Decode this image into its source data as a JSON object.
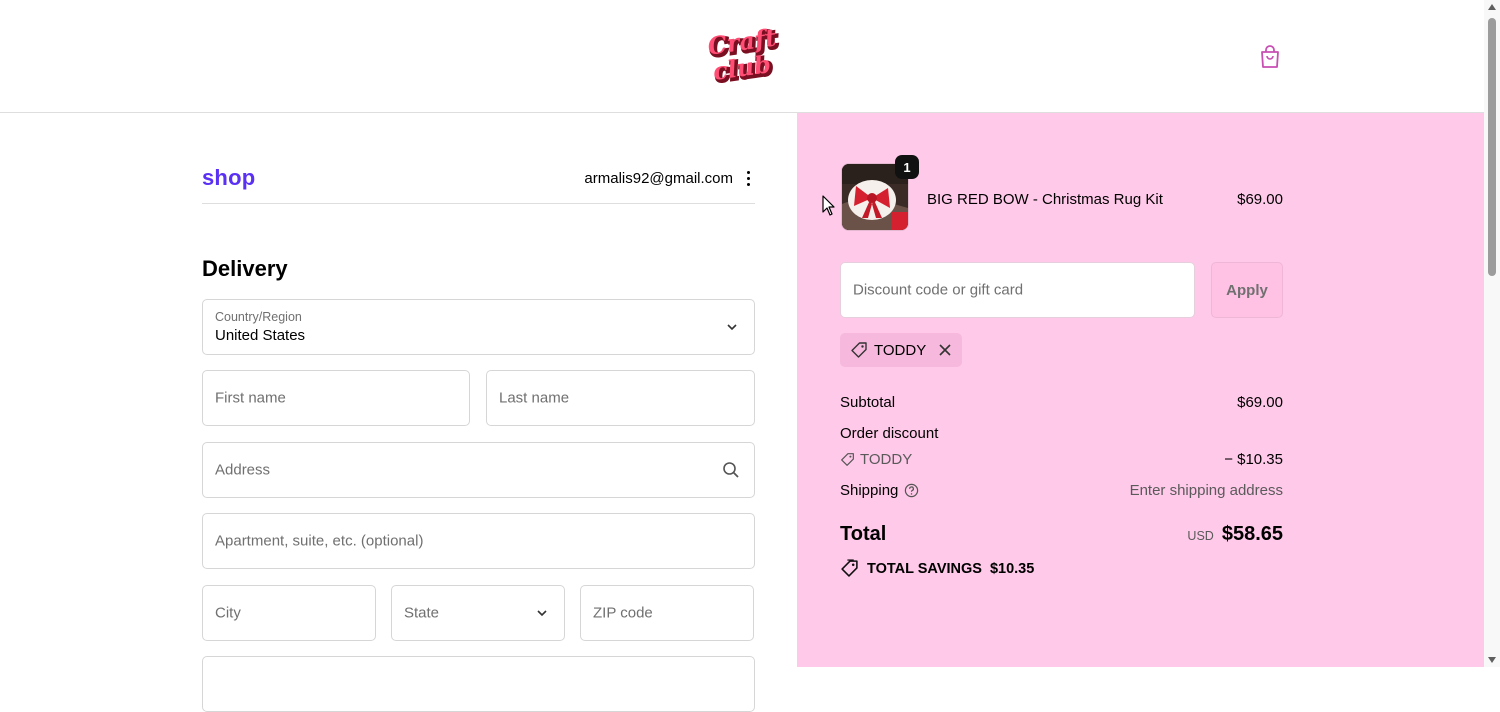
{
  "header": {
    "logo_text": [
      "Craft",
      "club"
    ],
    "cart_icon": "shopping-bag-icon"
  },
  "account": {
    "shop_logo": "shop",
    "email": "armalis92@gmail.com"
  },
  "delivery": {
    "title": "Delivery",
    "country_label": "Country/Region",
    "country_value": "United States",
    "first_name_placeholder": "First name",
    "last_name_placeholder": "Last name",
    "address_placeholder": "Address",
    "apartment_placeholder": "Apartment, suite, etc. (optional)",
    "city_placeholder": "City",
    "state_placeholder": "State",
    "zip_placeholder": "ZIP code"
  },
  "summary": {
    "item": {
      "name": "BIG RED BOW - Christmas Rug Kit",
      "price": "$69.00",
      "quantity": "1"
    },
    "discount_placeholder": "Discount code or gift card",
    "apply_label": "Apply",
    "applied_code": "TODDY",
    "subtotal_label": "Subtotal",
    "subtotal_value": "$69.00",
    "order_discount_label": "Order discount",
    "discount_code": "TODDY",
    "discount_value": "− $10.35",
    "shipping_label": "Shipping",
    "shipping_value": "Enter shipping address",
    "total_label": "Total",
    "total_currency": "USD",
    "total_value": "$58.65",
    "savings_label": "TOTAL SAVINGS",
    "savings_value": "$10.35"
  },
  "colors": {
    "accent_shop": "#5a31f4",
    "summary_bg": "#ffc9e9",
    "logo_red": "#e8374f"
  }
}
